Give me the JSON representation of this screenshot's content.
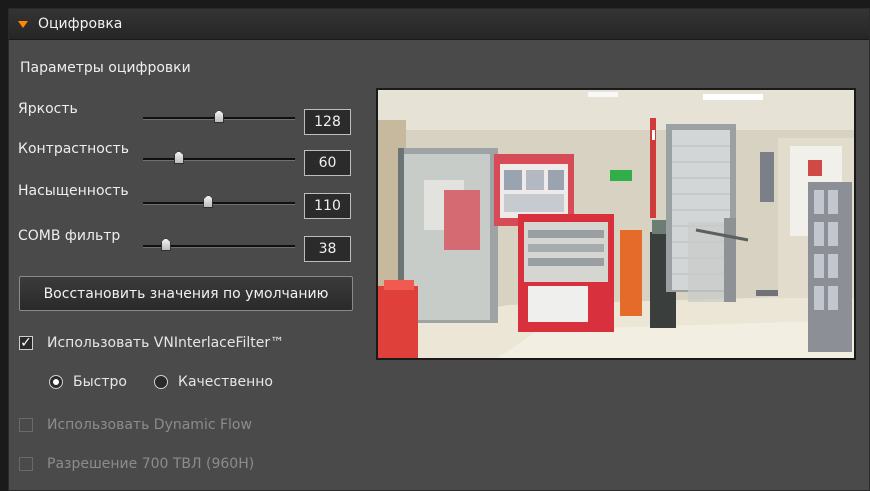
{
  "header": {
    "title": "Оцифровка"
  },
  "section_title": "Параметры оцифровки",
  "sliders": [
    {
      "label": "Яркость",
      "value": "128",
      "level": 0.5
    },
    {
      "label": "Контрастность",
      "value": "60",
      "level": 0.235
    },
    {
      "label": "Насыщенность",
      "value": "110",
      "level": 0.43
    },
    {
      "label": "COMB фильтр",
      "value": "38",
      "level": 0.15
    }
  ],
  "restore_button": "Восстановить значения по умолчанию",
  "vninterlace": {
    "label": "Использовать VNInterlaceFilter™",
    "checked": true
  },
  "mode": {
    "fast_label": "Быстро",
    "quality_label": "Качественно",
    "selected": "fast"
  },
  "dynamic_flow": {
    "label": "Использовать Dynamic Flow",
    "checked": false,
    "enabled": false
  },
  "resolution_960h": {
    "label": "Разрешение 700 ТВЛ (960H)",
    "checked": false,
    "enabled": false
  },
  "colors": {
    "accent": "#ff8a00",
    "panel": "#4a4a4a",
    "header": "#2c2c2c"
  }
}
